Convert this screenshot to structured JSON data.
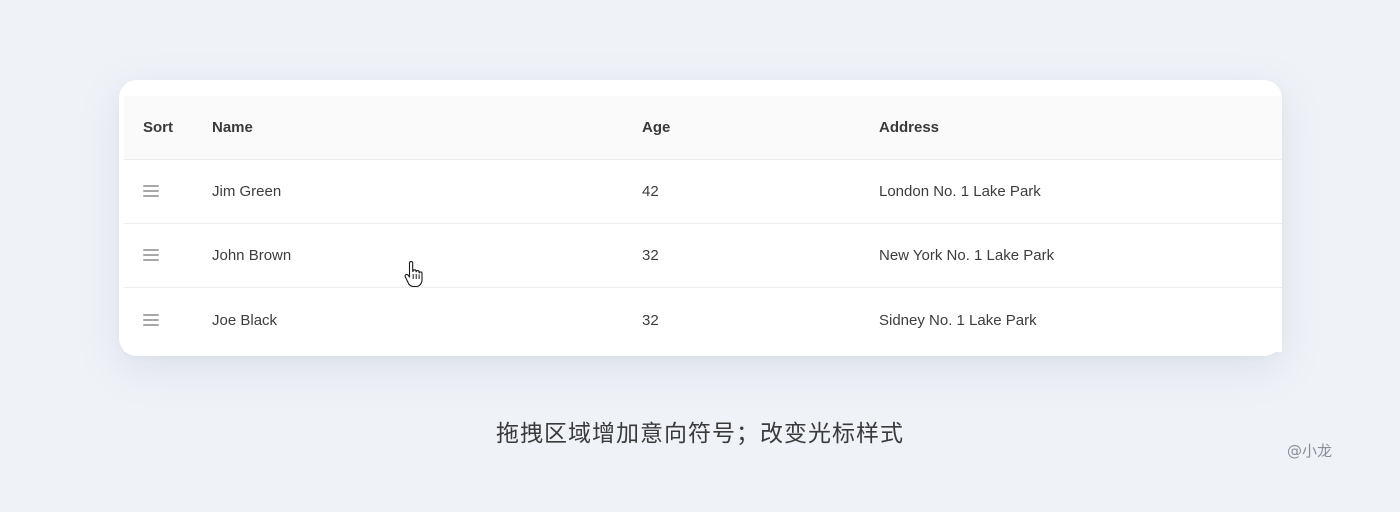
{
  "table": {
    "columns": {
      "sort": "Sort",
      "name": "Name",
      "age": "Age",
      "address": "Address"
    },
    "rows": [
      {
        "name": "Jim Green",
        "age": "42",
        "address": "London No. 1 Lake Park"
      },
      {
        "name": "John Brown",
        "age": "32",
        "address": "New York No. 1 Lake Park"
      },
      {
        "name": "Joe Black",
        "age": "32",
        "address": "Sidney No. 1 Lake Park"
      }
    ]
  },
  "icons": {
    "drag_handle": "drag-handle-icon",
    "cursor": "hand-pointer-cursor-icon"
  },
  "caption": "拖拽区域增加意向符号；改变光标样式",
  "watermark": "@小龙",
  "colors": {
    "background": "#eff2f7",
    "card": "#ffffff",
    "header_bg": "#fafafa",
    "divider": "#ececec",
    "handle": "#a8a8a8"
  }
}
